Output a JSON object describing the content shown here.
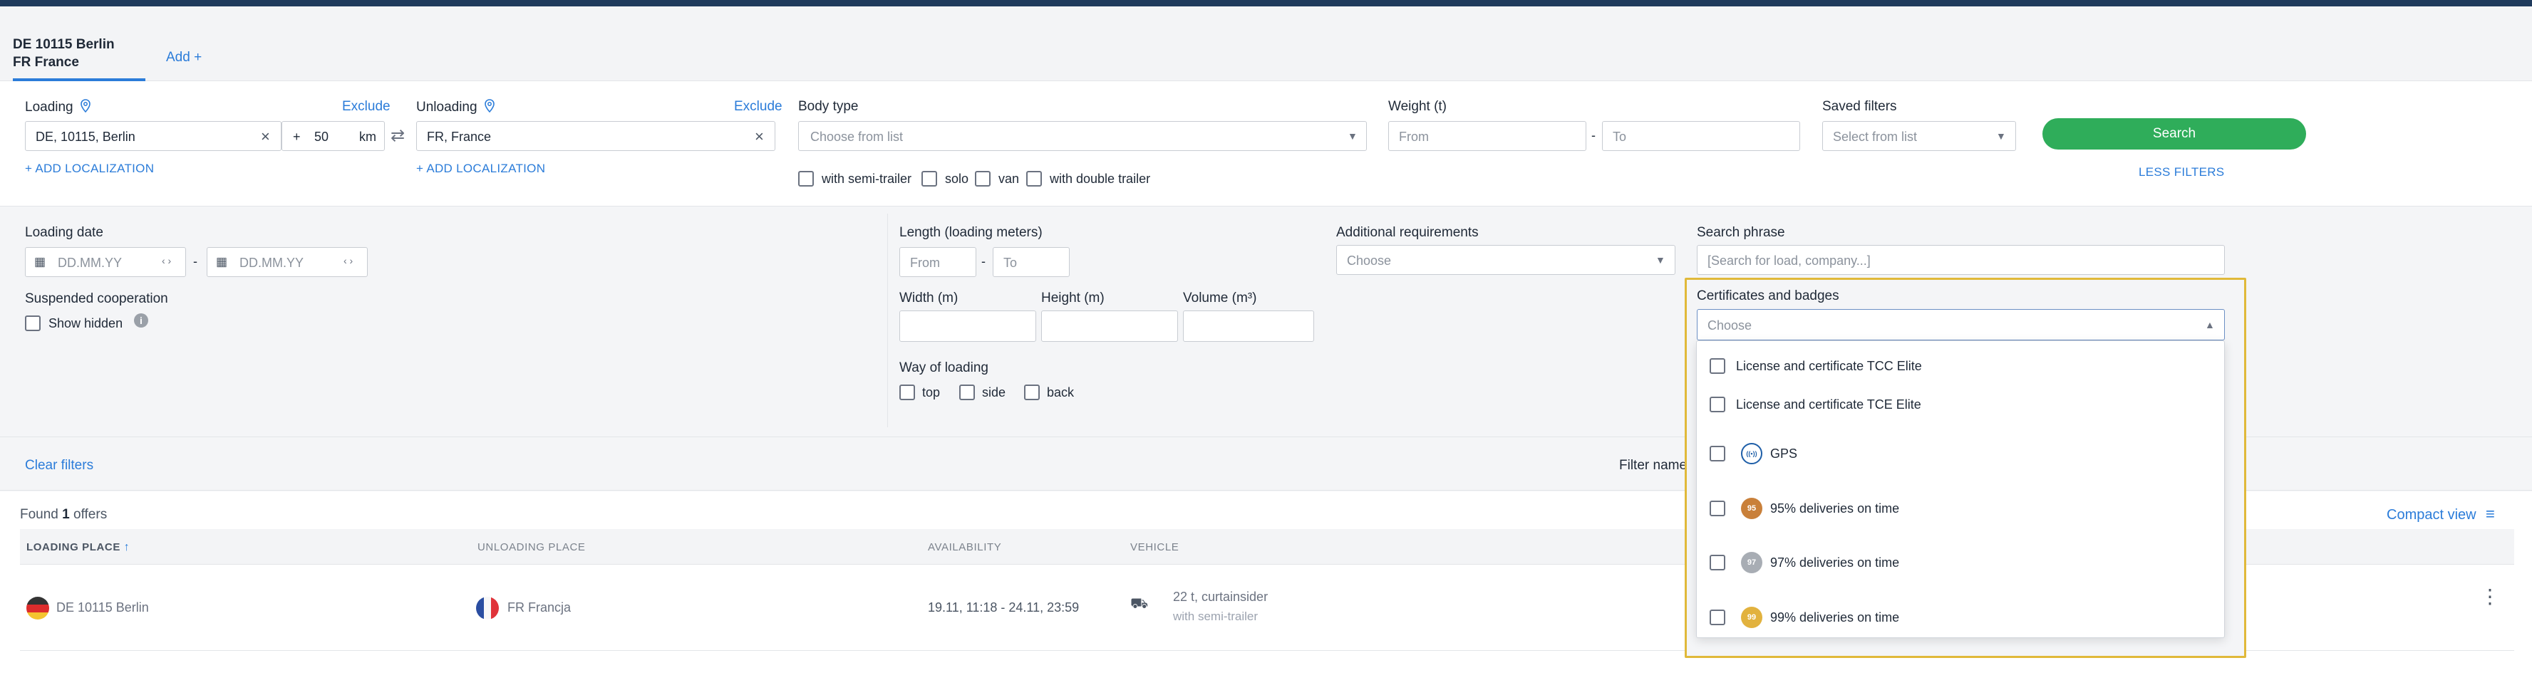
{
  "tabs": {
    "active_line1": "DE 10115 Berlin",
    "active_line2": "FR France",
    "add_label": "Add +"
  },
  "loading": {
    "label": "Loading",
    "exclude": "Exclude",
    "value": "DE, 10115, Berlin",
    "plus": "+",
    "radius": "50",
    "unit": "km",
    "add_localization": "+ ADD LOCALIZATION"
  },
  "unloading": {
    "label": "Unloading",
    "exclude": "Exclude",
    "value": "FR, France",
    "add_localization": "+ ADD LOCALIZATION"
  },
  "body_type": {
    "label": "Body type",
    "placeholder": "Choose from list",
    "options": [
      "with semi-trailer",
      "solo",
      "van",
      "with double trailer"
    ]
  },
  "weight": {
    "label": "Weight (t)",
    "from": "From",
    "to": "To",
    "dash": "-"
  },
  "saved_filters": {
    "label": "Saved filters",
    "placeholder": "Select from list"
  },
  "search_button": "Search",
  "less_filters": "LESS FILTERS",
  "loading_date": {
    "label": "Loading date",
    "from": "DD.MM.YY",
    "to": "DD.MM.YY",
    "dash": "-"
  },
  "suspended": {
    "label": "Suspended cooperation",
    "show_hidden": "Show hidden"
  },
  "length": {
    "label": "Length (loading meters)",
    "from": "From",
    "to": "To",
    "dash": "-"
  },
  "dimensions": {
    "width": "Width (m)",
    "height": "Height (m)",
    "volume": "Volume (m³)"
  },
  "way_of_loading": {
    "label": "Way of loading",
    "options": [
      "top",
      "side",
      "back"
    ]
  },
  "additional": {
    "label": "Additional requirements",
    "placeholder": "Choose"
  },
  "search_phrase": {
    "label": "Search phrase",
    "placeholder": "[Search for load, company...]"
  },
  "certificates": {
    "label": "Certificates and badges",
    "placeholder": "Choose",
    "options": [
      {
        "label": "License and certificate TCC Elite",
        "icon": "none"
      },
      {
        "label": "License and certificate TCE Elite",
        "icon": "none"
      },
      {
        "label": "GPS",
        "icon": "gps-icon",
        "badge_text": "((•))",
        "color": "#1f5fa8"
      },
      {
        "label": "95% deliveries on time",
        "icon": "badge-95-icon",
        "badge_text": "95",
        "color": "#c9803a"
      },
      {
        "label": "97% deliveries on time",
        "icon": "badge-97-icon",
        "badge_text": "97",
        "color": "#a8adb4"
      },
      {
        "label": "99% deliveries on time",
        "icon": "badge-99-icon",
        "badge_text": "99",
        "color": "#e2b23e"
      }
    ]
  },
  "clear_filters": "Clear filters",
  "filter_name": "Filter name",
  "results": {
    "found_prefix": "Found",
    "count": "1",
    "found_suffix": "offers",
    "compact_view": "Compact view",
    "columns": [
      "LOADING PLACE",
      "UNLOADING PLACE",
      "AVAILABILITY",
      "VEHICLE"
    ],
    "row": {
      "loading": "DE 10115 Berlin",
      "unloading": "FR Francja",
      "availability": "19.11, 11:18 - 24.11, 23:59",
      "vehicle_line1": "22 t, curtainsider",
      "vehicle_line2": "with semi-trailer"
    }
  },
  "colors": {
    "accent": "#2b7cd9",
    "search_button": "#2fad5a",
    "highlight": "#e0b93a",
    "top_bar": "#1f3a5c"
  }
}
